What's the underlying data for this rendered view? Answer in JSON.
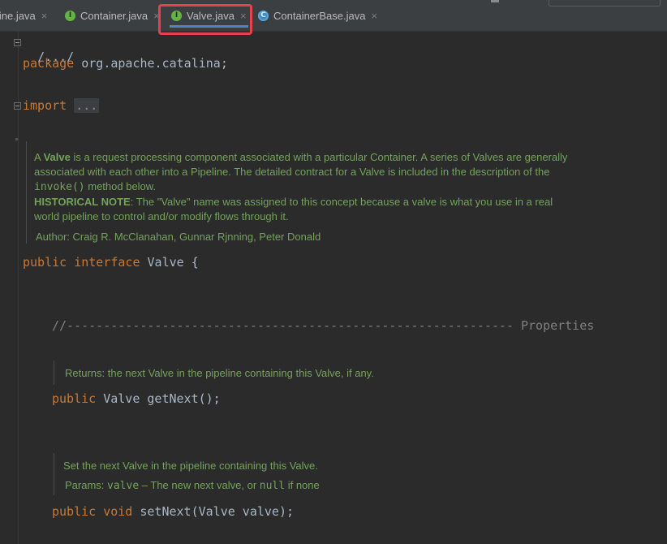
{
  "tabs": [
    {
      "label": "line.java",
      "icon": "interface-icon",
      "active": false
    },
    {
      "label": "Container.java",
      "icon": "interface-icon",
      "active": false
    },
    {
      "label": "Valve.java",
      "icon": "interface-icon",
      "active": true
    },
    {
      "label": "ContainerBase.java",
      "icon": "class-icon",
      "active": false
    }
  ],
  "tab_close_glyph": "×",
  "interface_glyph": "I",
  "class_glyph": "C",
  "code": {
    "fold_header": "/.../",
    "package_kw": "package",
    "package_name": " org.apache.catalina;",
    "import_kw": "import",
    "import_dots": "...",
    "decl_public": "public",
    "decl_interface": " interface",
    "decl_name": " Valve {",
    "properties_comment": "//------------------------------------------------------------- Properties",
    "getnext_public": "public",
    "getnext_rest": " Valve getNext();",
    "setnext_public": "public",
    "setnext_void": " void",
    "setnext_rest": " setNext(Valve valve);"
  },
  "doc_main": {
    "p1_a": "A ",
    "p1_valve": "Valve",
    "p1_b": " is a request processing component associated with a particular Container. A series of Valves are generally associated with each other into a Pipeline. The detailed contract for a Valve is included in the description of the ",
    "p1_invoke": "invoke()",
    "p1_c": " method below.",
    "p2_bold": "HISTORICAL NOTE",
    "p2_rest": ": The \"Valve\" name was assigned to this concept because a valve is what you use in a real world pipeline to control and/or modify flows through it.",
    "author": "Author: Craig R. McClanahan, Gunnar Rjnning, Peter Donald"
  },
  "doc_getnext": "Returns: the next Valve in the pipeline containing this Valve, if any.",
  "doc_setnext": {
    "line1": "Set the next Valve in the pipeline containing this Valve.",
    "params_label": "Params: ",
    "param_name": "valve",
    "param_desc": " – The new next valve, or ",
    "null_kw": "null",
    "param_end": " if none"
  },
  "colors": {
    "background": "#2b2b2b",
    "keyword": "#cc7832",
    "doc_text": "#73a35a",
    "highlight": "#e8414d",
    "active_tab": "#4a88c7"
  }
}
